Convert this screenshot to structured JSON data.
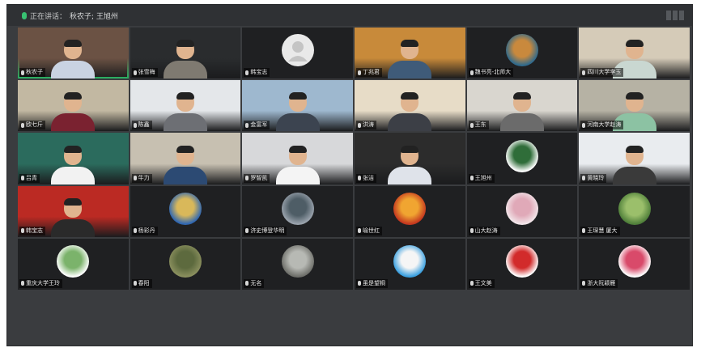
{
  "speaking_bar": {
    "label": "正在讲话：",
    "speakers": "秋农子; 王旭州"
  },
  "participants": [
    {
      "name": "秋农子",
      "row": 1,
      "col": 1,
      "active": true,
      "type": "video",
      "bg": "#6b5244",
      "shirt": "#c9d3e2"
    },
    {
      "name": "张雪梅",
      "row": 1,
      "col": 2,
      "type": "video",
      "bg": "#2a2c2e",
      "shirt": "#7f7a71"
    },
    {
      "name": "韩宝志",
      "row": 1,
      "col": 3,
      "type": "avatar-default"
    },
    {
      "name": "丁兆君",
      "row": 1,
      "col": 4,
      "type": "video",
      "bg": "#c88a3a",
      "shirt": "#3f5b79"
    },
    {
      "name": "魏书亮-北师大",
      "row": 1,
      "col": 5,
      "type": "avatar",
      "avatar_colors": [
        "#2f6a8d",
        "#c9893d"
      ]
    },
    {
      "name": "四川大学李玉",
      "row": 1,
      "col": 6,
      "type": "video",
      "bg": "#d5cbb8",
      "shirt": "#c9d7d1"
    },
    {
      "name": "欧七斤",
      "row": 2,
      "col": 1,
      "type": "video",
      "bg": "#c2b8a2",
      "shirt": "#7a2230"
    },
    {
      "name": "陈鑫",
      "row": 2,
      "col": 2,
      "type": "video",
      "bg": "#e4e7ea",
      "shirt": "#6d6f74"
    },
    {
      "name": "金富军",
      "row": 2,
      "col": 3,
      "type": "video",
      "bg": "#9eb8cf",
      "shirt": "#3c4450"
    },
    {
      "name": "洪涛",
      "row": 2,
      "col": 4,
      "type": "video",
      "bg": "#e7dcc7",
      "shirt": "#3c3f46"
    },
    {
      "name": "王东",
      "row": 2,
      "col": 5,
      "type": "video",
      "bg": "#d9d6cf",
      "shirt": "#6b6b6b"
    },
    {
      "name": "河南大学赵涛",
      "row": 2,
      "col": 6,
      "type": "video",
      "bg": "#b6b2a4",
      "shirt": "#8cc2a3"
    },
    {
      "name": "吕青",
      "row": 3,
      "col": 1,
      "type": "video",
      "bg": "#2b6b5d",
      "shirt": "#f2f2f2"
    },
    {
      "name": "牛力",
      "row": 3,
      "col": 2,
      "type": "video",
      "bg": "#c7c0b1",
      "shirt": "#2c4a73"
    },
    {
      "name": "罗智凯",
      "row": 3,
      "col": 3,
      "type": "video",
      "bg": "#d7d8da",
      "shirt": "#f4f4f4"
    },
    {
      "name": "张洁",
      "row": 3,
      "col": 4,
      "type": "video",
      "bg": "#2c2c2c",
      "shirt": "#dfe3ea"
    },
    {
      "name": "王旭州",
      "row": 3,
      "col": 5,
      "type": "avatar",
      "avatar_colors": [
        "#ffffff",
        "#2f6d39"
      ]
    },
    {
      "name": "黄晓玲",
      "row": 3,
      "col": 6,
      "type": "video",
      "bg": "#e9ecef",
      "shirt": "#3a3a3a"
    },
    {
      "name": "韩宝志",
      "row": 4,
      "col": 1,
      "type": "video",
      "bg": "#bb2a23",
      "shirt": "#2a2a2a"
    },
    {
      "name": "杨彩丹",
      "row": 4,
      "col": 2,
      "type": "avatar",
      "avatar_colors": [
        "#2f67b3",
        "#d9b85a"
      ]
    },
    {
      "name": "济史博登华明",
      "row": 4,
      "col": 3,
      "type": "avatar",
      "avatar_colors": [
        "#9aa3ad",
        "#4e5d66"
      ]
    },
    {
      "name": "喻世红",
      "row": 4,
      "col": 4,
      "type": "avatar",
      "avatar_colors": [
        "#c4371f",
        "#f0a531"
      ]
    },
    {
      "name": "山大赵涛",
      "row": 4,
      "col": 5,
      "type": "avatar",
      "avatar_colors": [
        "#f2e6ea",
        "#e0a9b8"
      ]
    },
    {
      "name": "王琛慧 厦大",
      "row": 4,
      "col": 6,
      "type": "avatar",
      "avatar_colors": [
        "#4f7f3a",
        "#9bbf6b"
      ]
    },
    {
      "name": "重庆大学王玲",
      "row": 5,
      "col": 1,
      "type": "avatar",
      "avatar_colors": [
        "#ffffff",
        "#7bb36b"
      ]
    },
    {
      "name": "春阳",
      "row": 5,
      "col": 2,
      "type": "avatar",
      "avatar_colors": [
        "#8a8f5e",
        "#5d6a3e"
      ]
    },
    {
      "name": "无名",
      "row": 5,
      "col": 3,
      "type": "avatar",
      "avatar_colors": [
        "#6e6f6a",
        "#b7b9b4"
      ]
    },
    {
      "name": "虽是望桐",
      "row": 5,
      "col": 4,
      "type": "avatar",
      "avatar_colors": [
        "#3aa0e0",
        "#f5f5f5"
      ]
    },
    {
      "name": "王文美",
      "row": 5,
      "col": 5,
      "type": "avatar",
      "avatar_colors": [
        "#ffffff",
        "#d22b2b"
      ]
    },
    {
      "name": "浙大阮颖雁",
      "row": 5,
      "col": 6,
      "type": "avatar",
      "avatar_colors": [
        "#ffffff",
        "#d94a6a"
      ]
    }
  ]
}
